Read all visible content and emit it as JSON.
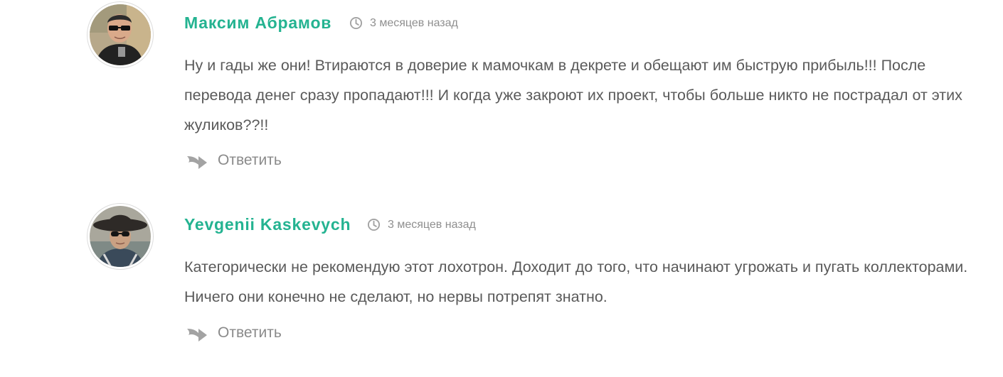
{
  "comments": [
    {
      "author": "Максим Абрамов",
      "time": "3 месяцев назад",
      "text": "Ну и гады же они! Втираются в доверие к мамочкам в декрете и обещают им быструю прибыль!!! После перевода денег сразу пропадают!!! И когда уже закроют их проект, чтобы больше никто не пострадал от этих жуликов??!!",
      "reply_label": "Ответить",
      "avatar_icon": "user-photo",
      "time_icon": "clock-icon",
      "reply_icon": "reply-arrow-icon"
    },
    {
      "author": "Yevgenii Kaskevych",
      "time": "3 месяцев назад",
      "text": "Категорически не рекомендую этот лохотрон. Доходит до того, что начинают угрожать и пугать коллекторами. Ничего они конечно не сделают, но нервы потрепят знатно.",
      "reply_label": "Ответить",
      "avatar_icon": "user-photo",
      "time_icon": "clock-icon",
      "reply_icon": "reply-arrow-icon"
    }
  ],
  "colors": {
    "author": "#24b391",
    "text": "#5a5a5a",
    "meta": "#8f8f8f",
    "icon": "#a3a3a3"
  }
}
